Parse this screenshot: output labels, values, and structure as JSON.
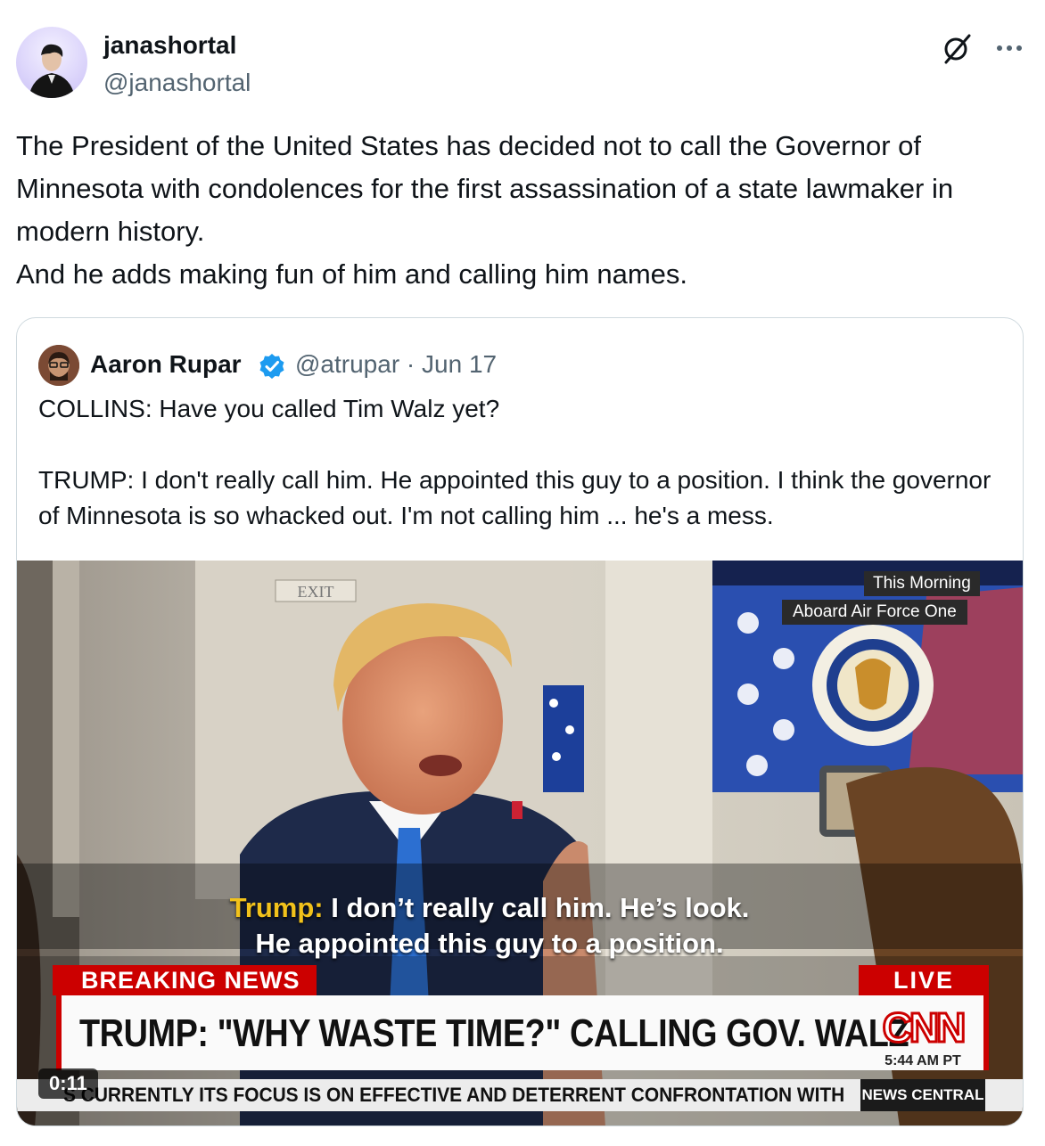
{
  "post": {
    "author_name": "janashortal",
    "author_handle": "@janashortal",
    "text": "The President of the United States has decided not to call the Governor of Minnesota with condolences for the first assassination of a state lawmaker in modern history.\nAnd he adds making fun of him and calling him names.",
    "icons": [
      "grok-icon",
      "more-options-icon"
    ]
  },
  "quote": {
    "author_name": "Aaron Rupar",
    "verified": true,
    "author_handle": "@atrupar",
    "separator": "·",
    "date": "Jun 17",
    "meta_line": "@atrupar · Jun 17",
    "text": "COLLINS: Have you called Tim Walz yet?\n\nTRUMP: I don't really call him. He appointed this guy to a position. I think the governor of Minnesota is so whacked out. I'm not calling him ... he's a mess."
  },
  "video": {
    "overlay_top": "This Morning",
    "overlay_bottom": "Aboard Air Force One",
    "exit_sign": "EXIT",
    "caption_speaker": "Trump:",
    "caption_line1": "I don’t really call him. He’s look.",
    "caption_line2": "He appointed this guy to a position.",
    "breaking_label": "BREAKING NEWS",
    "live_label": "LIVE",
    "headline": "TRUMP: \"WHY WASTE TIME?\" CALLING GOV. WALZ",
    "network_logo": "CNN",
    "timestamp": "5:44 AM PT",
    "ticker": "S CURRENTLY ITS FOCUS IS ON EFFECTIVE AND DETERRENT CONFRONTATION WITH",
    "ticker_brand": "NEWS CENTRAL",
    "duration": "0:11",
    "colors": {
      "cnn_red": "#cc0000",
      "caption_speaker": "#f2c21b",
      "link_blue": "#1d9bf0"
    }
  }
}
